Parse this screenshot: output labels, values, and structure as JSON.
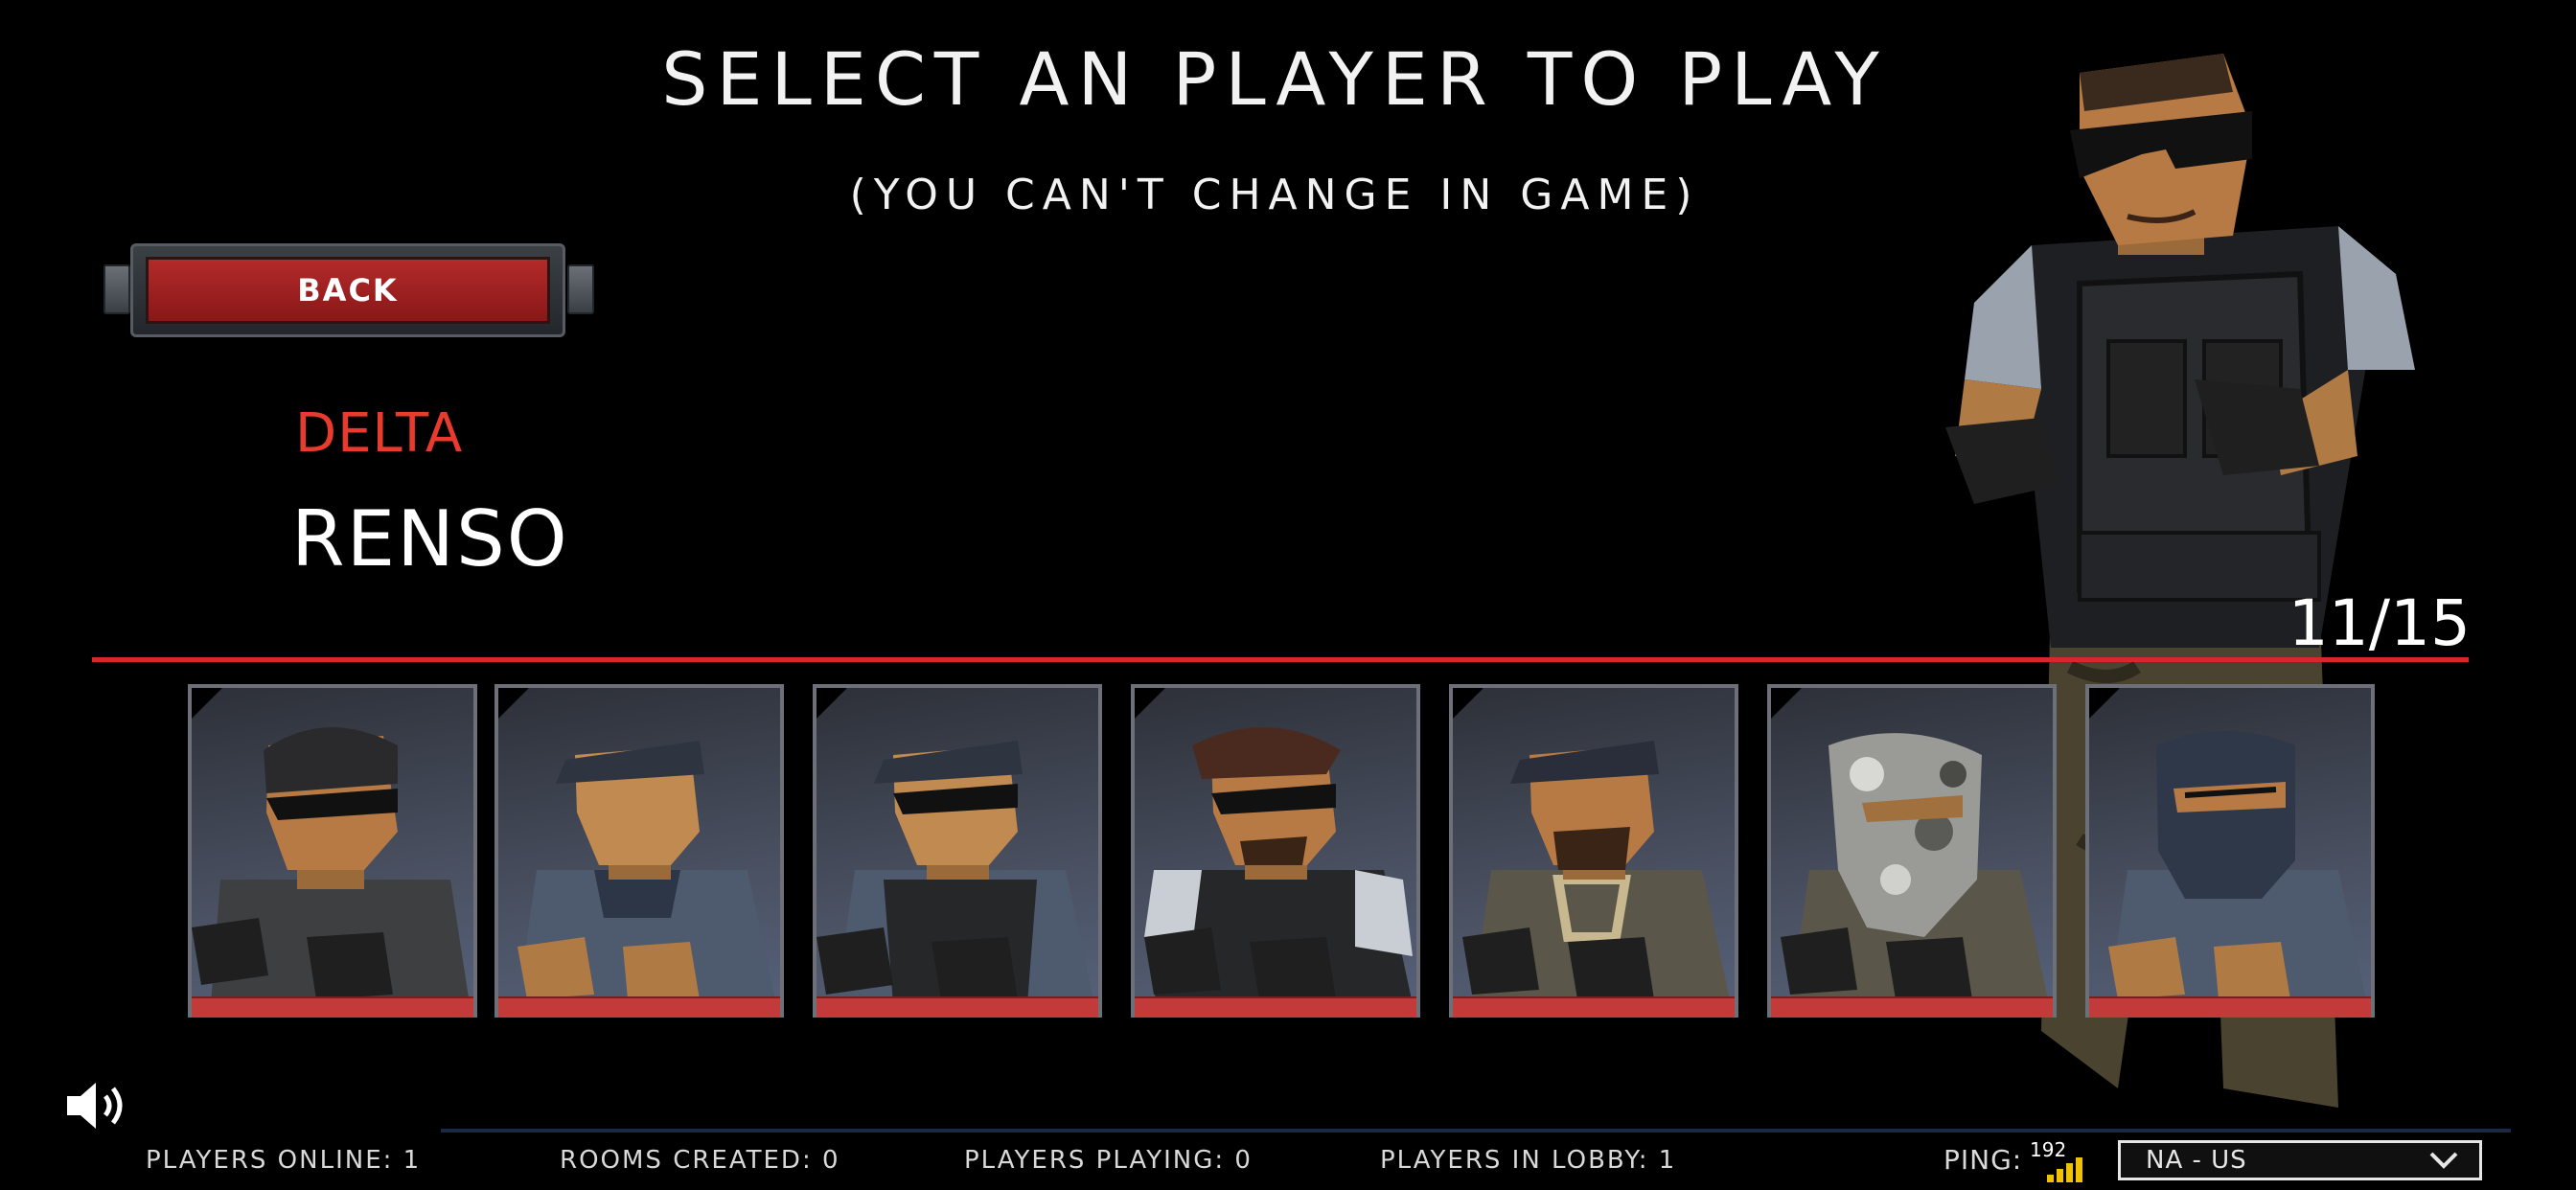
{
  "header": {
    "title": "SELECT AN PLAYER TO PLAY",
    "subtitle": "(YOU CAN'T CHANGE IN GAME)"
  },
  "back_button": {
    "label": "BACK"
  },
  "selected": {
    "team": "DELTA",
    "name": "RENSO",
    "counter": "11/15"
  },
  "colors": {
    "accent_red": "#d8262b",
    "team_red": "#e83b2e"
  },
  "cards": [
    {
      "icon": "soldier-beanie-sunglasses-icon"
    },
    {
      "icon": "soldier-cap-icon"
    },
    {
      "icon": "soldier-cap-sunglasses-vest-icon"
    },
    {
      "icon": "soldier-beret-sunglasses-icon"
    },
    {
      "icon": "soldier-cap-beard-icon"
    },
    {
      "icon": "soldier-camo-mask-icon"
    },
    {
      "icon": "soldier-balaclava-icon"
    }
  ],
  "status": {
    "players_online": "PLAYERS ONLINE: 1",
    "rooms_created": "ROOMS CREATED: 0",
    "players_playing": "PLAYERS PLAYING: 0",
    "players_in_lobby": "PLAYERS IN LOBBY: 1",
    "ping_label": "PING:",
    "ping_value": "192",
    "region": "NA - US"
  }
}
